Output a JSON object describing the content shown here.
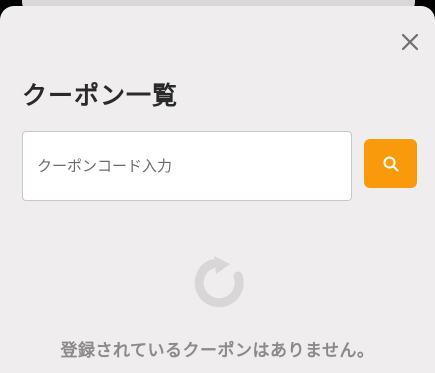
{
  "modal": {
    "title": "クーポン一覧",
    "close_icon": "close-icon"
  },
  "search": {
    "placeholder": "クーポンコード入力",
    "value": "",
    "button_icon": "search-icon",
    "button_color": "#f99a0c"
  },
  "empty_state": {
    "icon": "empty-coupon-icon",
    "message": "登録されているクーポンはありません。"
  }
}
